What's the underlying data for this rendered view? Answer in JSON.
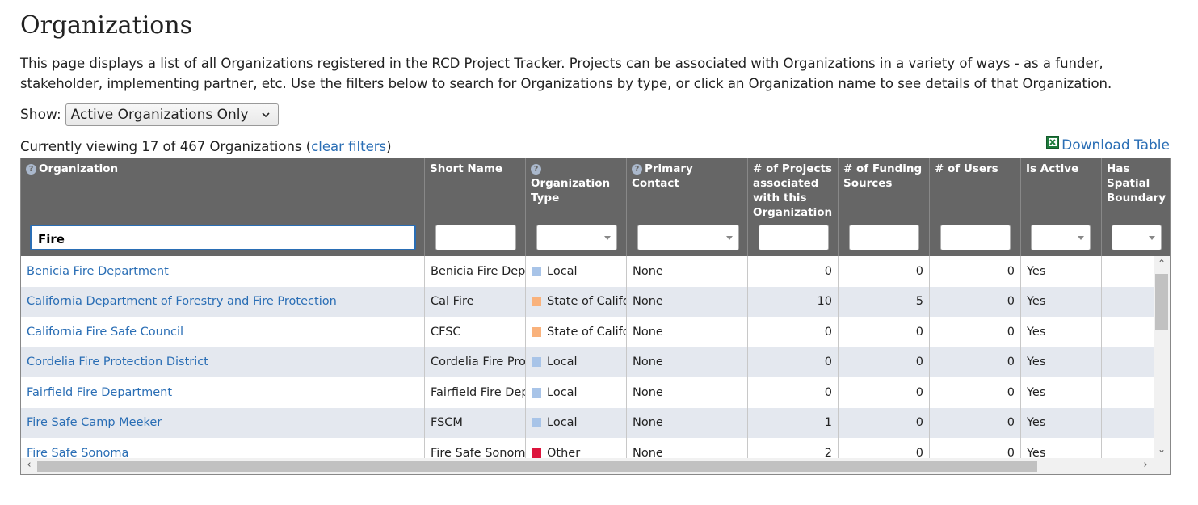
{
  "page": {
    "title": "Organizations",
    "intro": "This page displays a list of all Organizations registered in the RCD Project Tracker. Projects can be associated with Organizations in a variety of ways - as a funder, stakeholder, implementing partner, etc. Use the filters below to search for Organizations by type, or click an Organization name to see details of that Organization."
  },
  "show_filter": {
    "label": "Show:",
    "selected": "Active Organizations Only"
  },
  "summary": {
    "prefix": "Currently viewing 17 of 467 Organizations (",
    "clear_filters": "clear filters",
    "suffix": ")"
  },
  "download": {
    "label": "Download Table",
    "icon": "excel-icon"
  },
  "columns": [
    {
      "label": "Organization",
      "help": true
    },
    {
      "label": "Short Name",
      "help": false
    },
    {
      "label": "Organization Type",
      "help": true
    },
    {
      "label": "Primary Contact",
      "help": true
    },
    {
      "label": "# of Projects associated with this Organization",
      "help": false
    },
    {
      "label": "# of Funding Sources",
      "help": false
    },
    {
      "label": "# of Users",
      "help": false
    },
    {
      "label": "Is Active",
      "help": false
    },
    {
      "label": "Has Spatial Boundary",
      "help": false
    }
  ],
  "filters": {
    "organization": "Fire"
  },
  "type_colors": {
    "Local": "#a8c4e8",
    "State of California": "#f9b27c",
    "Other": "#dc143c"
  },
  "rows": [
    {
      "organization": "Benicia Fire Department",
      "short_name": "Benicia Fire Department",
      "type": "Local",
      "primary_contact": "None",
      "projects": "0",
      "funding_sources": "0",
      "users": "0",
      "is_active": "Yes",
      "spatial": ""
    },
    {
      "organization": "California Department of Forestry and Fire Protection",
      "short_name": "Cal Fire",
      "type": "State of California",
      "primary_contact": "None",
      "projects": "10",
      "funding_sources": "5",
      "users": "0",
      "is_active": "Yes",
      "spatial": ""
    },
    {
      "organization": "California Fire Safe Council",
      "short_name": "CFSC",
      "type": "State of California",
      "primary_contact": "None",
      "projects": "0",
      "funding_sources": "0",
      "users": "0",
      "is_active": "Yes",
      "spatial": ""
    },
    {
      "organization": "Cordelia Fire Protection District",
      "short_name": "Cordelia Fire Protection District",
      "type": "Local",
      "primary_contact": "None",
      "projects": "0",
      "funding_sources": "0",
      "users": "0",
      "is_active": "Yes",
      "spatial": ""
    },
    {
      "organization": "Fairfield Fire Department",
      "short_name": "Fairfield Fire Department",
      "type": "Local",
      "primary_contact": "None",
      "projects": "0",
      "funding_sources": "0",
      "users": "0",
      "is_active": "Yes",
      "spatial": ""
    },
    {
      "organization": "Fire Safe Camp Meeker",
      "short_name": "FSCM",
      "type": "Local",
      "primary_contact": "None",
      "projects": "1",
      "funding_sources": "0",
      "users": "0",
      "is_active": "Yes",
      "spatial": ""
    },
    {
      "organization": "Fire Safe Sonoma",
      "short_name": "Fire Safe Sonoma",
      "type": "Other",
      "primary_contact": "None",
      "projects": "2",
      "funding_sources": "0",
      "users": "0",
      "is_active": "Yes",
      "spatial": ""
    }
  ]
}
